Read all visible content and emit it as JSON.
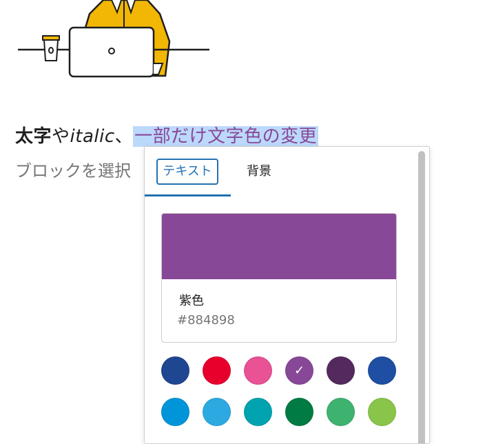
{
  "editor": {
    "paragraph": {
      "bold": "太字",
      "conj": "や",
      "italic": "italic",
      "sep": "、",
      "selected": "一部だけ文字色の変更"
    },
    "hint": "ブロックを選択"
  },
  "color_popover": {
    "tabs": [
      {
        "label": "テキスト",
        "active": true
      },
      {
        "label": "背景",
        "active": false
      }
    ],
    "selected_color": {
      "name": "紫色",
      "hex": "#884898"
    },
    "palette": [
      {
        "hex": "#1f4691",
        "selected": false
      },
      {
        "hex": "#e8002d",
        "selected": false
      },
      {
        "hex": "#e95295",
        "selected": false
      },
      {
        "hex": "#884898",
        "selected": true
      },
      {
        "hex": "#542a5e",
        "selected": false
      },
      {
        "hex": "#1f4fa3",
        "selected": false
      },
      {
        "hex": "#0095d9",
        "selected": false
      },
      {
        "hex": "#2ca9e1",
        "selected": false
      },
      {
        "hex": "#00a3af",
        "selected": false
      },
      {
        "hex": "#007b43",
        "selected": false
      },
      {
        "hex": "#3eb370",
        "selected": false
      },
      {
        "hex": "#8ac54b",
        "selected": false
      }
    ],
    "check_glyph": "✓"
  }
}
